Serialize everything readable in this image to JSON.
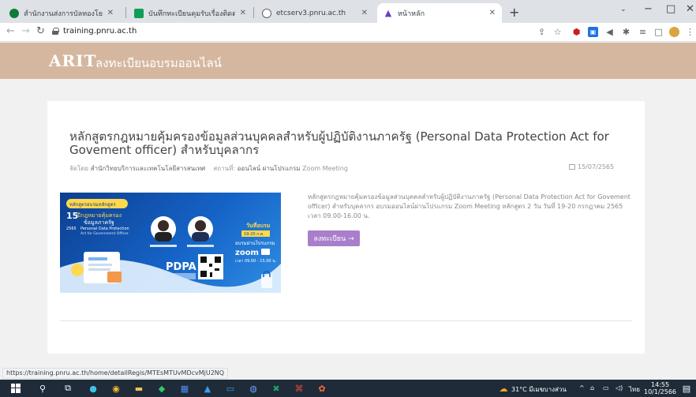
{
  "browser": {
    "tabs": [
      {
        "title": "สำนักงานส่งการบัลทองโยนายนะ",
        "fav_color": "#0f7a3a",
        "active": false
      },
      {
        "title": "บันทึกทะเบียนคุมรับเรื่องติดตอส ปีเ",
        "fav_color": "#0f9d58",
        "active": false
      },
      {
        "title": "etcserv3.pnru.ac.th",
        "fav_color": "#5f6368",
        "active": false
      },
      {
        "title": "หน้าหลัก",
        "fav_color": "#6a3fc4",
        "active": true
      }
    ],
    "new_tab": "+",
    "window_controls": {
      "minimize": "−",
      "maximize": "□",
      "close": "✕"
    },
    "url": "training.pnru.ac.th",
    "status_url": "https://training.pnru.ac.th/home/detailRegis/MTEsMTUvMDcvMjU2NQ"
  },
  "site": {
    "logo_text": "ARIT",
    "title": "ลงทะเบียนอบรมออนไลน์",
    "header_color": "#d5b7a0"
  },
  "course": {
    "title": "หลักสูตรกฎหมายคุ้มครองข้อมูลส่วนบุคคลสำหรับผู้ปฏิบัติงานภาครัฐ (Personal Data Protection Act for Govement officer) สำหรับบุคลากร",
    "organizer_label": "จัดโดย",
    "organizer": "สำนักวิทยบริการและเทคโนโลยีสารสนเทศ",
    "location_label": "สถานที่:",
    "location": "ออนไลน์ ผ่านโปรแกรม",
    "location_tool": "Zoom Meeting",
    "date": "15/07/2565",
    "description": "หลักสูตรกฎหมายคุ้มครองข้อมูลส่วนบุคคลสำหรับผู้ปฏิบัติงานภาครัฐ (Personal Data Protection Act for Govement officer) สำหรับบุคลากร อบรมออนไลน์ผ่านโปรแกรม Zoom Meeting หลักสูตร 2 วัน วันที่ 19-20 กรกฎาคม 2565 เวลา 09.00-16.00 น.",
    "register_label": "ลงทะเบียน →",
    "button_color": "#a97ecb"
  },
  "banner": {
    "top_label": "หลักสูตรอบรมหลักสูตร",
    "big_number": "15",
    "line1": "ปีกฎหมายคุ้มครอง",
    "line2": "ข้อมูลภาครัฐ",
    "line3": "Personal Data Protection",
    "line4": "Act for Government Officer",
    "year": "2565",
    "schedule_title": "วันที่อบรม",
    "schedule_dates": "19-20 ก.ค.",
    "online_label": "อบรมผ่านโปรแกรม",
    "zoom_label": "zoom",
    "time_label": "เวลา 09.00 - 15.00 น.",
    "pdpa_label": "PDPA"
  },
  "taskbar": {
    "weather": "31°C มีเมฆบางส่วน",
    "lang": "ไทย",
    "time": "14:55",
    "date": "10/1/2566"
  }
}
